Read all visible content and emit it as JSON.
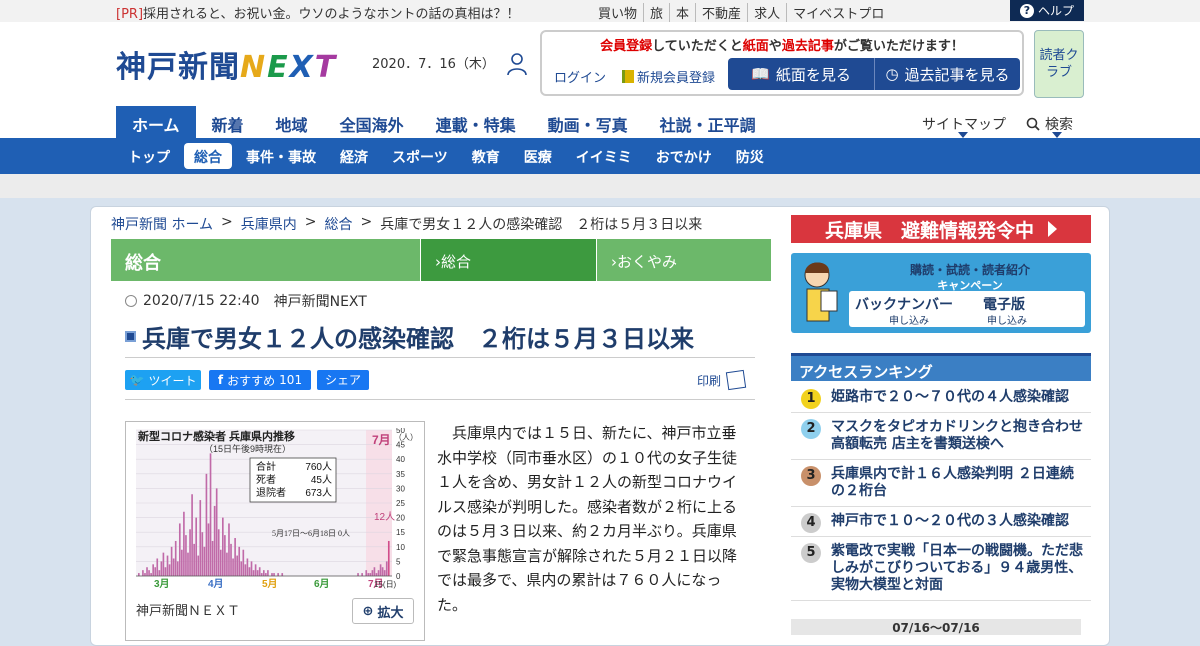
{
  "topbar": {
    "pr_tag": "[PR]",
    "pr_text": "採用されると、お祝い金。ウソのようなホントの話の真相は？！",
    "links": [
      "買い物",
      "旅",
      "本",
      "不動産",
      "求人",
      "マイベストプロ"
    ],
    "help": "ヘルプ"
  },
  "header": {
    "logo_kanji": "神戸新聞",
    "logo_next": [
      "N",
      "E",
      "X",
      "T"
    ],
    "date": "2020．7．16（木）",
    "member_notice_parts": [
      "会員登録",
      "していただくと",
      "紙面",
      "や",
      "過去記事",
      "がご覧いただけます！"
    ],
    "login": "ログイン",
    "new_member": "新規会員登録",
    "paper_button": "紙面を見る",
    "archive_button": "過去記事を見る",
    "readers_club": "読者クラブ"
  },
  "mainnav": {
    "items": [
      "ホーム",
      "新着",
      "地域",
      "全国海外",
      "連載・特集",
      "動画・写真",
      "社説・正平調"
    ],
    "active": 0,
    "sitemap": "サイトマップ",
    "search": "検索"
  },
  "subnav": {
    "items": [
      "トップ",
      "総合",
      "事件・事故",
      "経済",
      "スポーツ",
      "教育",
      "医療",
      "イイミミ",
      "おでかけ",
      "防災"
    ],
    "active": 1
  },
  "breadcrumb": [
    "神戸新聞 ホーム",
    "兵庫県内",
    "総合",
    "兵庫で男女１２人の感染確認　２桁は５月３日以来"
  ],
  "category_bar": {
    "main": "総合",
    "sub1": "総合",
    "sub2": "おくやみ"
  },
  "article": {
    "datetime": "2020/7/15 22:40",
    "source": "神戸新聞NEXT",
    "title": "兵庫で男女１２人の感染確認　２桁は５月３日以来",
    "tweet": "ツイート",
    "fb_recommend": "おすすめ",
    "fb_count": "101",
    "fb_share": "シェア",
    "print": "印刷",
    "body": "兵庫県内では１５日、新たに、神戸市立垂水中学校（同市垂水区）の１０代の女子生徒１人を含め、男女計１２人の新型コロナウイルス感染が判明した。感染者数が２桁に上るのは５月３日以来、約２カ月半ぶり。兵庫県で緊急事態宣言が解除された５月２１日以降では最多で、県内の累計は７６０人になった。",
    "figure_caption": "神戸新聞ＮＥＸＴ",
    "zoom": "拡大"
  },
  "chart_data": {
    "type": "bar",
    "title": "新型コロナ感染者 兵庫県内推移",
    "subtitle": "（15日午後9時現在）",
    "ylabel": "（人）",
    "ylim": [
      0,
      50
    ],
    "yticks": [
      0,
      5,
      10,
      15,
      20,
      25,
      30,
      35,
      40,
      45,
      50
    ],
    "months": [
      "3月",
      "4月",
      "5月",
      "6月",
      "7月"
    ],
    "month_colors": [
      "#3a9a3a",
      "#3a6fc4",
      "#e0a010",
      "#3a9a3a",
      "#c0407a"
    ],
    "x_end_label": "15(日)",
    "totals": [
      {
        "label": "合計",
        "value": "760人"
      },
      {
        "label": "死者",
        "value": "45人"
      },
      {
        "label": "退院者",
        "value": "673人"
      }
    ],
    "annotation_gap": "5月17日～6月18日 0人",
    "annotation_last": "12人",
    "values": [
      1,
      0,
      2,
      1,
      3,
      2,
      1,
      4,
      3,
      6,
      2,
      5,
      8,
      3,
      7,
      4,
      10,
      6,
      12,
      5,
      18,
      9,
      22,
      14,
      8,
      16,
      28,
      11,
      20,
      7,
      26,
      15,
      10,
      35,
      18,
      42,
      12,
      24,
      30,
      16,
      9,
      20,
      14,
      8,
      18,
      11,
      6,
      13,
      7,
      10,
      5,
      9,
      4,
      6,
      3,
      5,
      2,
      4,
      2,
      3,
      1,
      2,
      1,
      2,
      0,
      1,
      1,
      0,
      1,
      0,
      1,
      0,
      0,
      0,
      0,
      0,
      0,
      0,
      0,
      0,
      0,
      0,
      0,
      0,
      0,
      0,
      0,
      0,
      0,
      0,
      0,
      0,
      0,
      0,
      0,
      0,
      0,
      0,
      0,
      0,
      0,
      0,
      0,
      0,
      0,
      0,
      0,
      1,
      0,
      1,
      0,
      2,
      1,
      1,
      2,
      3,
      1,
      2,
      4,
      3,
      2,
      5,
      12
    ]
  },
  "sidebar": {
    "alert": "兵庫県　避難情報発令中",
    "campaign_title": "購読・試読・読者紹介",
    "campaign_sub": "キャンペーン",
    "backnumber": "バックナンバー",
    "backnumber_sub": "申し込み",
    "digital": "電子版",
    "digital_sub": "申し込み",
    "ranking_title": "アクセスランキング",
    "ranking": [
      {
        "num": "1",
        "text": "姫路市で２０～７０代の４人感染確認",
        "color": "#f2d21e"
      },
      {
        "num": "2",
        "text": "マスクをタピオカドリンクと抱き合わせ高額転売 店主を書類送検へ",
        "color": "#8fd0ee"
      },
      {
        "num": "3",
        "text": "兵庫県内で計１６人感染判明 ２日連続の２桁台",
        "color": "#c8906a"
      },
      {
        "num": "4",
        "text": "神戸市で１０～２０代の３人感染確認",
        "color": "#cccccc"
      },
      {
        "num": "5",
        "text": "紫電改で実戦「日本一の戦闘機。ただ悲しみがこびりついておる」９４歳男性、実物大模型と対面",
        "color": "#cccccc"
      }
    ],
    "ranking_period": "07/16～07/16"
  }
}
